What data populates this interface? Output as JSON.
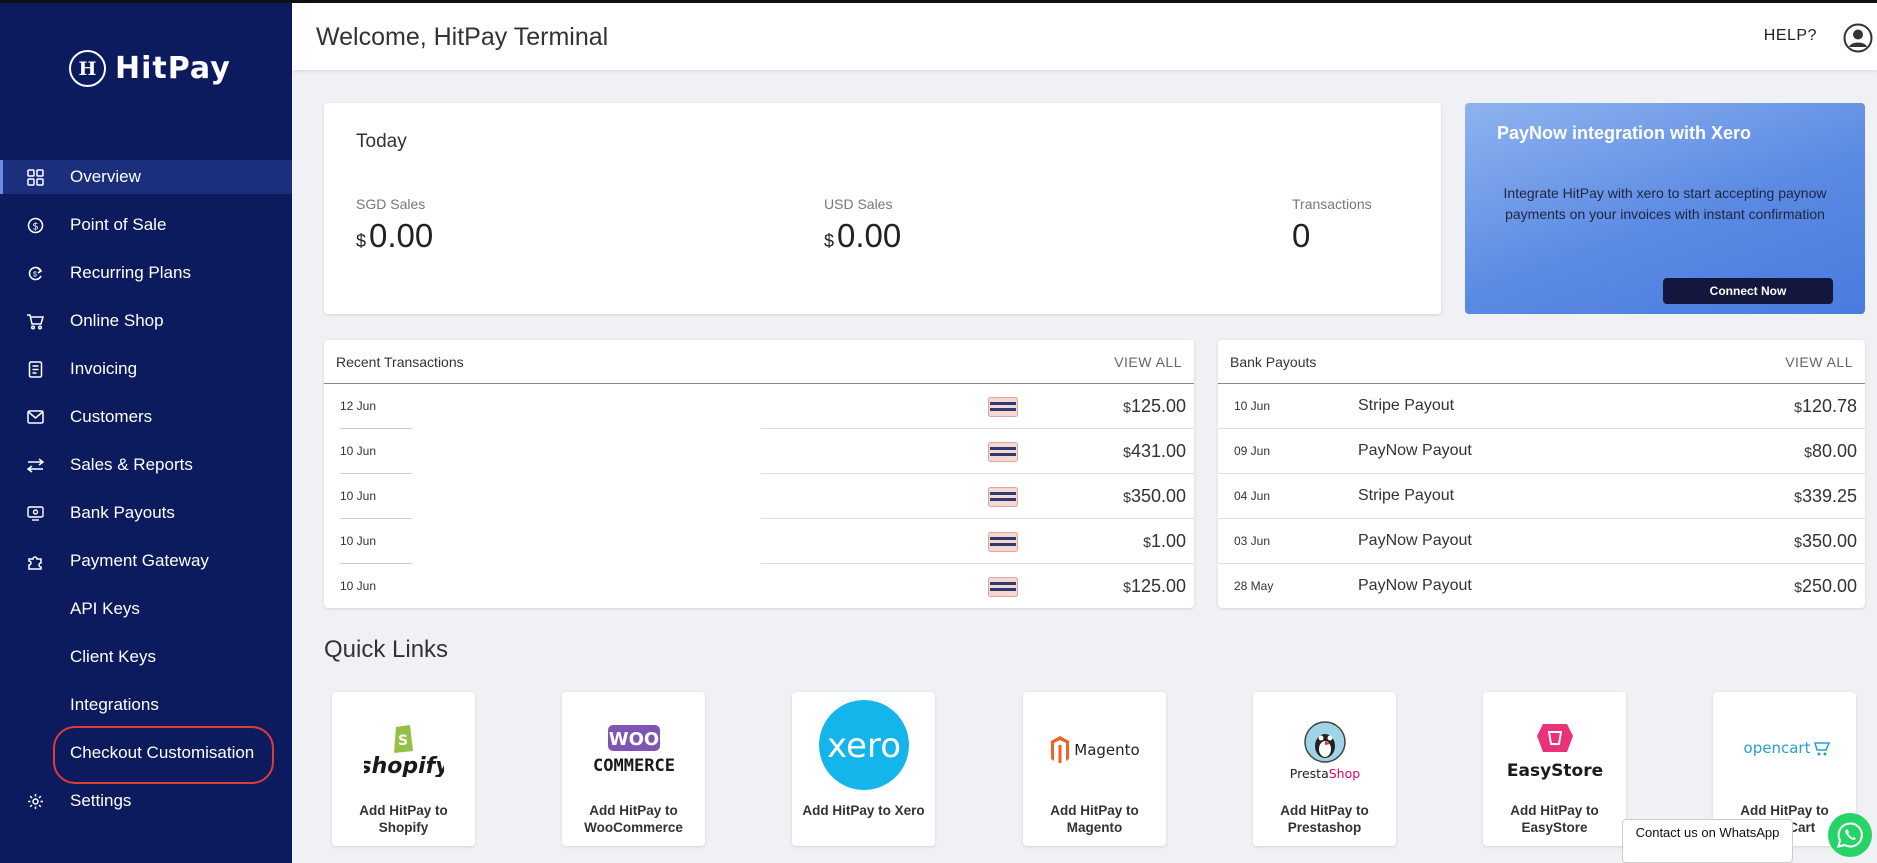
{
  "brand": {
    "name": "HitPay",
    "mark": "H"
  },
  "sidebar": {
    "items": [
      {
        "label": "Overview",
        "icon": "grid-icon"
      },
      {
        "label": "Point of Sale",
        "icon": "dollar-circle-icon"
      },
      {
        "label": "Recurring Plans",
        "icon": "recurring-icon"
      },
      {
        "label": "Online Shop",
        "icon": "cart-icon"
      },
      {
        "label": "Invoicing",
        "icon": "invoice-icon"
      },
      {
        "label": "Customers",
        "icon": "mail-icon"
      },
      {
        "label": "Sales & Reports",
        "icon": "swap-arrows-icon"
      },
      {
        "label": "Bank Payouts",
        "icon": "payout-icon"
      },
      {
        "label": "Payment Gateway",
        "icon": "puzzle-icon"
      },
      {
        "label": "API Keys",
        "icon": ""
      },
      {
        "label": "Client Keys",
        "icon": ""
      },
      {
        "label": "Integrations",
        "icon": ""
      },
      {
        "label": "Checkout Customisation",
        "icon": ""
      },
      {
        "label": "Settings",
        "icon": "gear-icon"
      }
    ]
  },
  "header": {
    "title": "Welcome, HitPay Terminal",
    "help": "HELP?"
  },
  "today": {
    "title": "Today",
    "stats": [
      {
        "label": "SGD Sales",
        "currency": "$",
        "value": "0.00"
      },
      {
        "label": "USD Sales",
        "currency": "$",
        "value": "0.00"
      },
      {
        "label": "Transactions",
        "currency": "",
        "value": "0"
      }
    ]
  },
  "promo": {
    "title": "PayNow integration with Xero",
    "text": "Integrate HitPay with xero to start accepting paynow payments on your invoices with instant confirmation",
    "button": "Connect Now"
  },
  "recent_transactions": {
    "title": "Recent Transactions",
    "view_all": "VIEW ALL",
    "rows": [
      {
        "date": "12 Jun",
        "currency": "$",
        "amount": "125.00"
      },
      {
        "date": "10 Jun",
        "currency": "$",
        "amount": "431.00"
      },
      {
        "date": "10 Jun",
        "currency": "$",
        "amount": "350.00"
      },
      {
        "date": "10 Jun",
        "currency": "$",
        "amount": "1.00"
      },
      {
        "date": "10 Jun",
        "currency": "$",
        "amount": "125.00"
      }
    ]
  },
  "bank_payouts": {
    "title": "Bank Payouts",
    "view_all": "VIEW ALL",
    "rows": [
      {
        "date": "10 Jun",
        "desc": "Stripe Payout",
        "currency": "$",
        "amount": "120.78"
      },
      {
        "date": "09 Jun",
        "desc": "PayNow Payout",
        "currency": "$",
        "amount": "80.00"
      },
      {
        "date": "04 Jun",
        "desc": "Stripe Payout",
        "currency": "$",
        "amount": "339.25"
      },
      {
        "date": "03 Jun",
        "desc": "PayNow Payout",
        "currency": "$",
        "amount": "350.00"
      },
      {
        "date": "28 May",
        "desc": "PayNow Payout",
        "currency": "$",
        "amount": "250.00"
      }
    ]
  },
  "quick_links": {
    "title": "Quick Links",
    "tiles": [
      {
        "logo": "shopify",
        "label": "Add HitPay to Shopify"
      },
      {
        "logo": "WOO COMMERCE",
        "label": "Add HitPay to WooCommerce"
      },
      {
        "logo": "xero",
        "label": "Add HitPay to Xero"
      },
      {
        "logo": "Magento",
        "label": "Add HitPay to Magento"
      },
      {
        "logo": "PrestaShop",
        "label": "Add HitPay to Prestashop"
      },
      {
        "logo": "EasyStore",
        "label": "Add HitPay to EasyStore"
      },
      {
        "logo": "opencart",
        "label": "Add HitPay to OpenCart"
      }
    ]
  },
  "whatsapp": {
    "text": "Contact us on WhatsApp"
  },
  "colors": {
    "sidebar": "#0c1a5e",
    "accent": "#4a7bdf",
    "highlight_ring": "#e23a3a",
    "whatsapp": "#25d366"
  }
}
